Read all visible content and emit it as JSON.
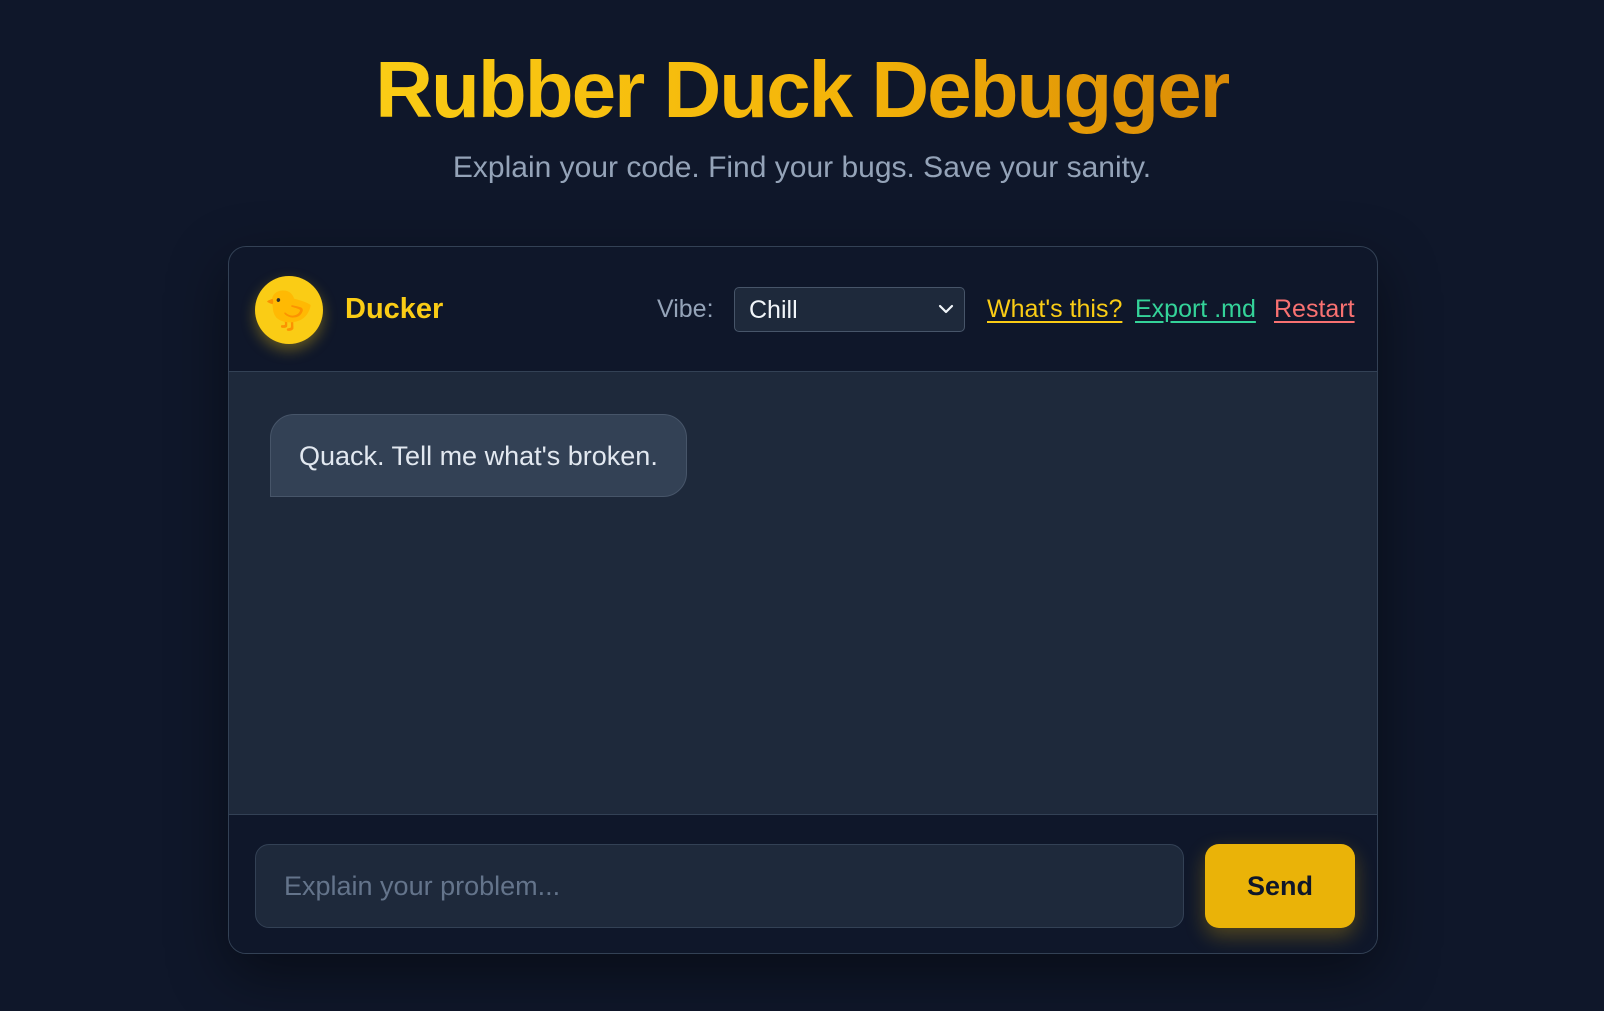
{
  "app": {
    "title": "Rubber Duck Debugger",
    "subtitle": "Explain your code. Find your bugs. Save your sanity."
  },
  "header": {
    "avatar_icon": "duck-icon",
    "avatar_glyph": "🐤",
    "bot_name": "Ducker",
    "vibe_label": "Vibe:",
    "vibe_selected": "Chill",
    "links": {
      "whats_this": "What's this?",
      "export": "Export .md",
      "restart": "Restart"
    }
  },
  "messages": [
    {
      "from": "bot",
      "text": "Quack. Tell me what's broken."
    }
  ],
  "composer": {
    "placeholder": "Explain your problem...",
    "value": "",
    "send_label": "Send"
  },
  "colors": {
    "background": "#0f172a",
    "accent_yellow": "#facc15",
    "accent_green": "#34d399",
    "accent_red": "#f87171",
    "send_button": "#eab308"
  }
}
